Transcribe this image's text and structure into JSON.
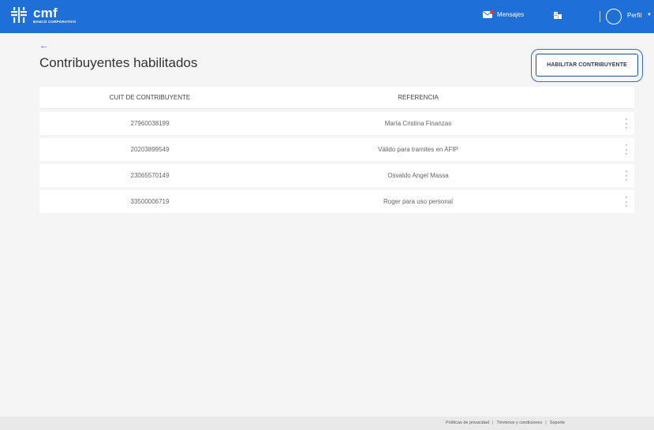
{
  "header": {
    "brand": "cmf",
    "brand_sub": "BANCO CORPORATIVO",
    "messages_label": "Mensajes",
    "profile_label": "Perfil",
    "colors": {
      "bar": "#1e6fd8",
      "text": "#ffffff",
      "badge": "#e53935"
    }
  },
  "page": {
    "back_glyph": "←",
    "title": "Contribuyentes habilitados",
    "cta_label": "HABILITAR CONTRIBUYENTE"
  },
  "table": {
    "columns": [
      "CUIT DE CONTRIBUYENTE",
      "REFERENCIA"
    ],
    "rows": [
      {
        "cuit": "27960038199",
        "ref": "María Cristina Finanzas"
      },
      {
        "cuit": "20203899549",
        "ref": "Válido para tramites en AFIP"
      },
      {
        "cuit": "23065570149",
        "ref": "Osvaldo Angel Massa"
      },
      {
        "cuit": "33500006719",
        "ref": "Roger para uso personal"
      }
    ]
  },
  "footer": {
    "links": [
      "Políticas de privacidad",
      "Términos y condiciones",
      "Soporte"
    ],
    "separator": "|"
  }
}
